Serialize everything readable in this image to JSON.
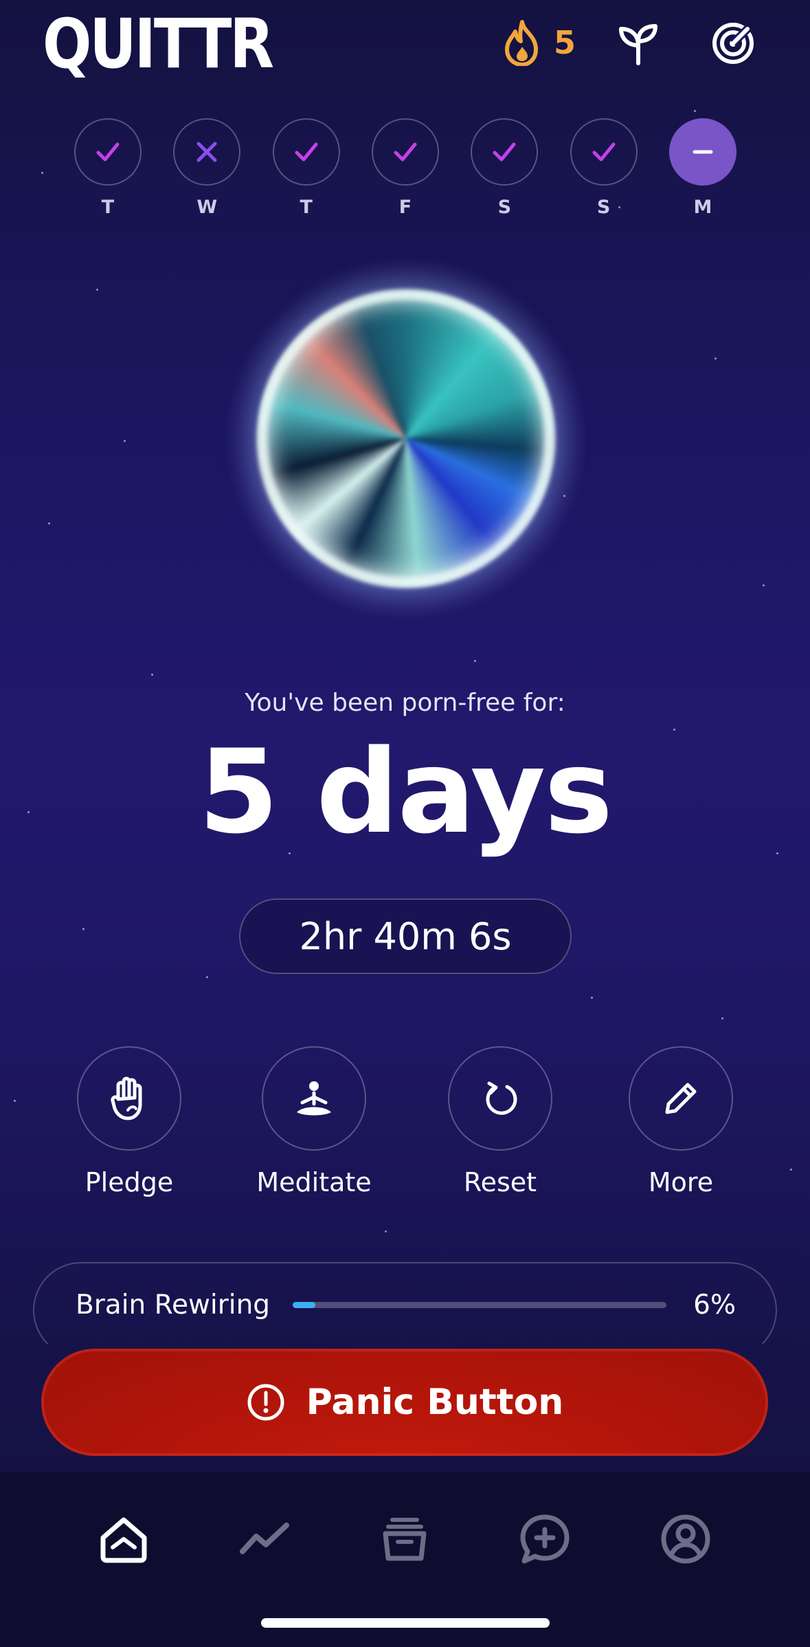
{
  "app": {
    "logo_text": "QUITTR"
  },
  "header": {
    "streak_count": "5"
  },
  "week": [
    {
      "label": "T",
      "status": "check"
    },
    {
      "label": "W",
      "status": "cross"
    },
    {
      "label": "T",
      "status": "check"
    },
    {
      "label": "F",
      "status": "check"
    },
    {
      "label": "S",
      "status": "check"
    },
    {
      "label": "S",
      "status": "check"
    },
    {
      "label": "M",
      "status": "today"
    }
  ],
  "counter": {
    "subtitle": "You've been porn-free for:",
    "days": "5 days",
    "time": "2hr 40m 6s"
  },
  "actions": [
    {
      "label": "Pledge",
      "icon": "hand-icon"
    },
    {
      "label": "Meditate",
      "icon": "meditate-icon"
    },
    {
      "label": "Reset",
      "icon": "reset-icon"
    },
    {
      "label": "More",
      "icon": "pencil-icon"
    }
  ],
  "rewiring": {
    "label": "Brain Rewiring",
    "percent_text": "6%",
    "progress": 0.06
  },
  "panic": {
    "label": "Panic Button"
  },
  "nav": [
    "home-icon",
    "chart-icon",
    "library-icon",
    "chat-add-icon",
    "profile-icon"
  ],
  "colors": {
    "accent_orange": "#f2a63b",
    "check_purple": "#c640e8",
    "today_purple": "#7a55c8",
    "panic_red": "#b2150a",
    "progress_blue": "#3ab0f0"
  }
}
